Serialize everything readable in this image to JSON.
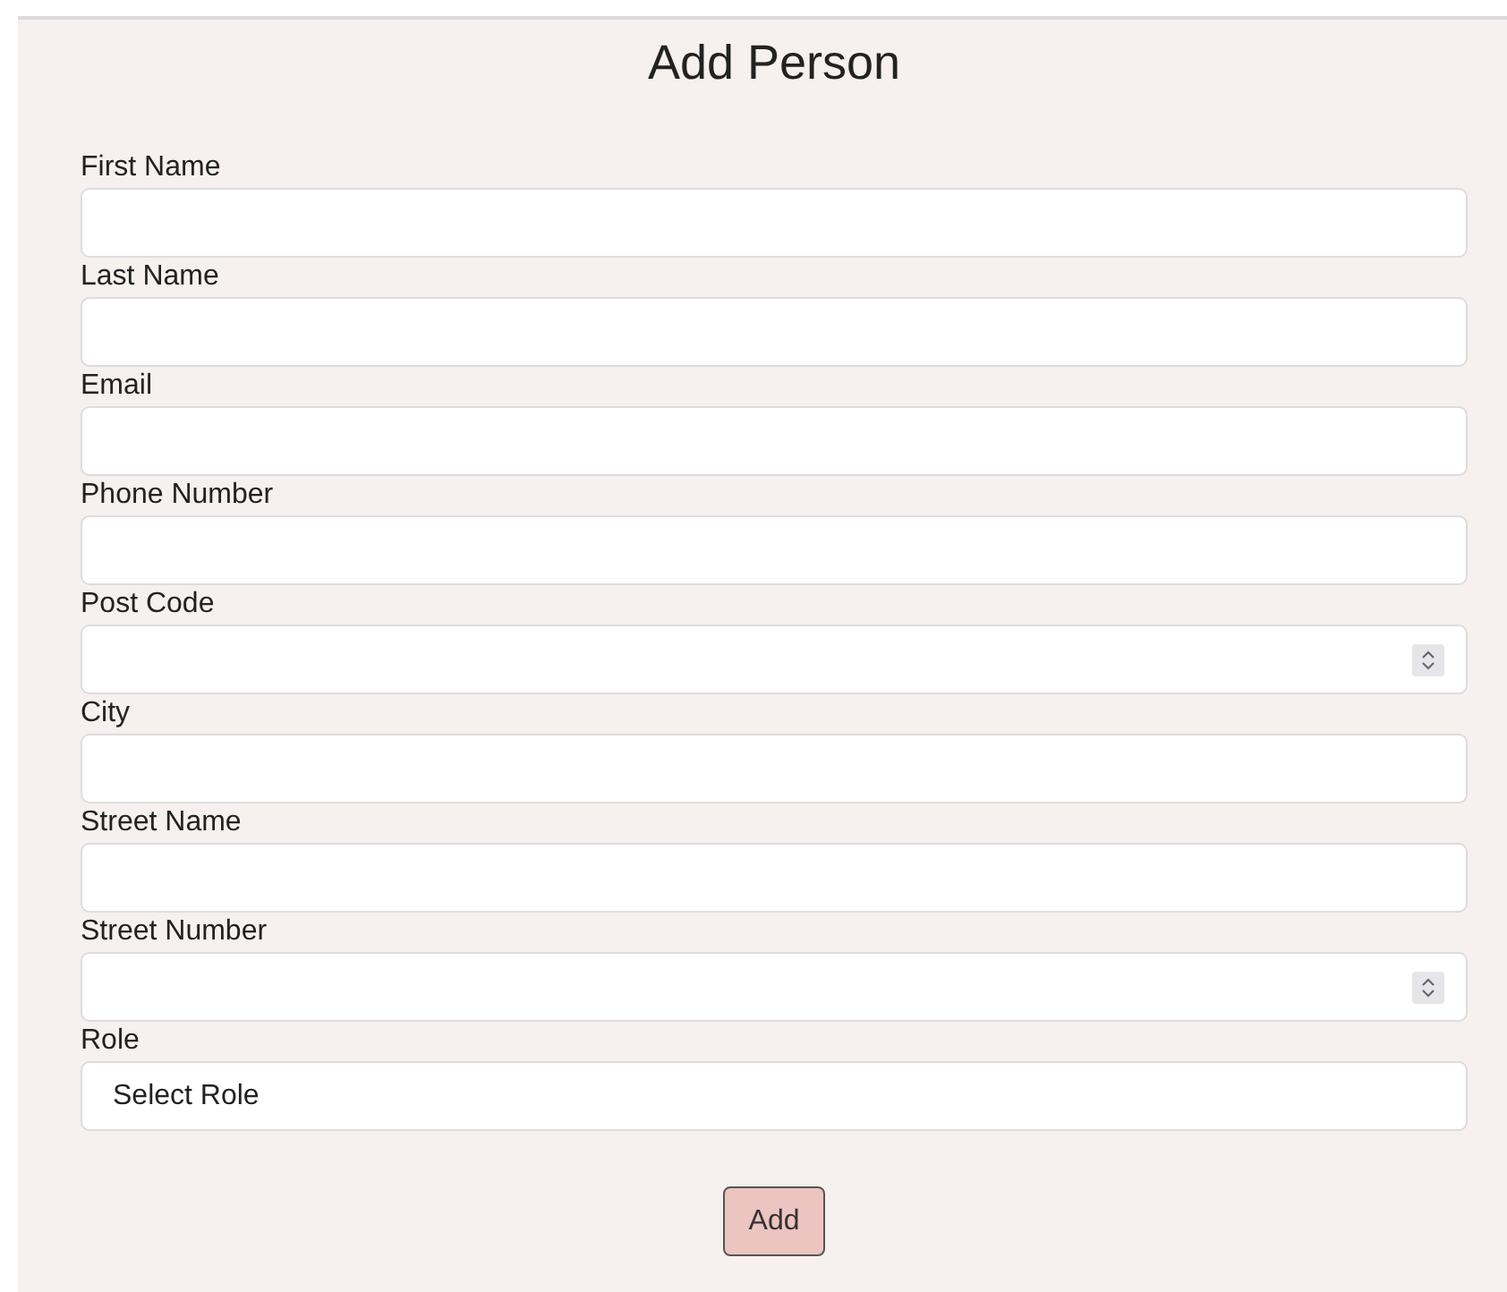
{
  "title": "Add Person",
  "fields": [
    {
      "label": "First Name",
      "kind": "text"
    },
    {
      "label": "Last Name",
      "kind": "text"
    },
    {
      "label": "Email",
      "kind": "text"
    },
    {
      "label": "Phone Number",
      "kind": "text"
    },
    {
      "label": "Post Code",
      "kind": "number"
    },
    {
      "label": "City",
      "kind": "text"
    },
    {
      "label": "Street Name",
      "kind": "text"
    },
    {
      "label": "Street Number",
      "kind": "number"
    },
    {
      "label": "Role",
      "kind": "select",
      "value": "Select Role"
    }
  ],
  "submit": "Add"
}
